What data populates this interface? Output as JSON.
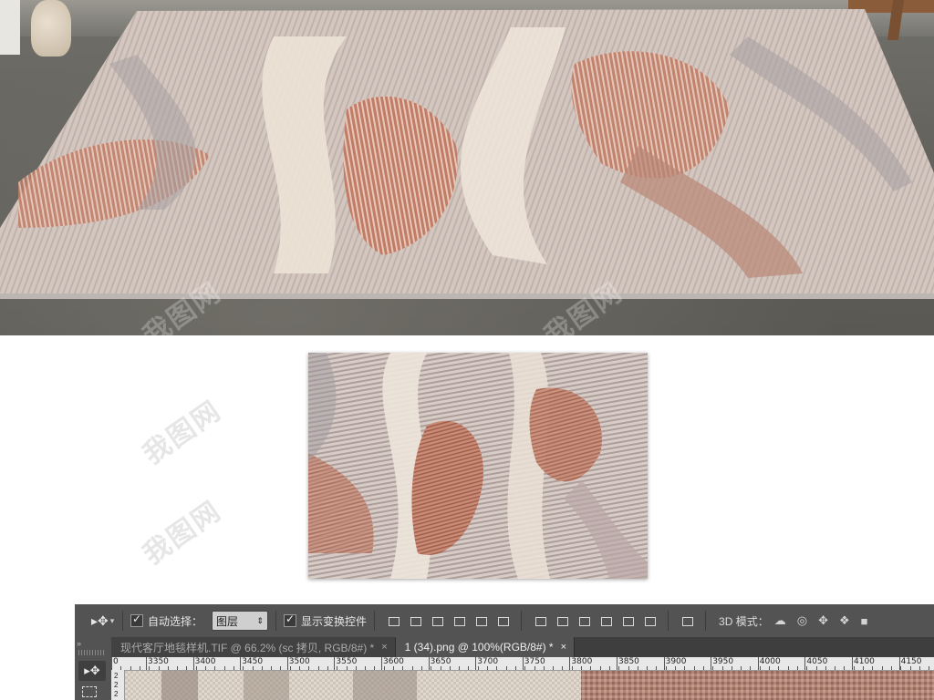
{
  "watermark": "我图网",
  "photoshop": {
    "options_bar": {
      "auto_select_label": "自动选择：",
      "auto_select_value": "图层",
      "show_transform_label": "显示变换控件",
      "mode_label": "3D 模式："
    },
    "tabs": [
      {
        "title": "现代客厅地毯样机.TIF @ 66.2% (sc 拷贝, RGB/8#) *",
        "active": false
      },
      {
        "title": "1 (34).png @ 100%(RGB/8#) *",
        "active": true
      }
    ],
    "close_glyph": "×",
    "ruler_labels": [
      "0",
      "3350",
      "3400",
      "3450",
      "3500",
      "3550",
      "3600",
      "3650",
      "3700",
      "3750",
      "3800",
      "3850",
      "3900",
      "3950",
      "4000",
      "4050",
      "4100",
      "4150"
    ],
    "vertical_ruler_labels": [
      "2",
      "2",
      "2"
    ],
    "icons": {
      "move_tool": "move-arrow-icon",
      "collapse": "double-chevron-icon"
    }
  }
}
